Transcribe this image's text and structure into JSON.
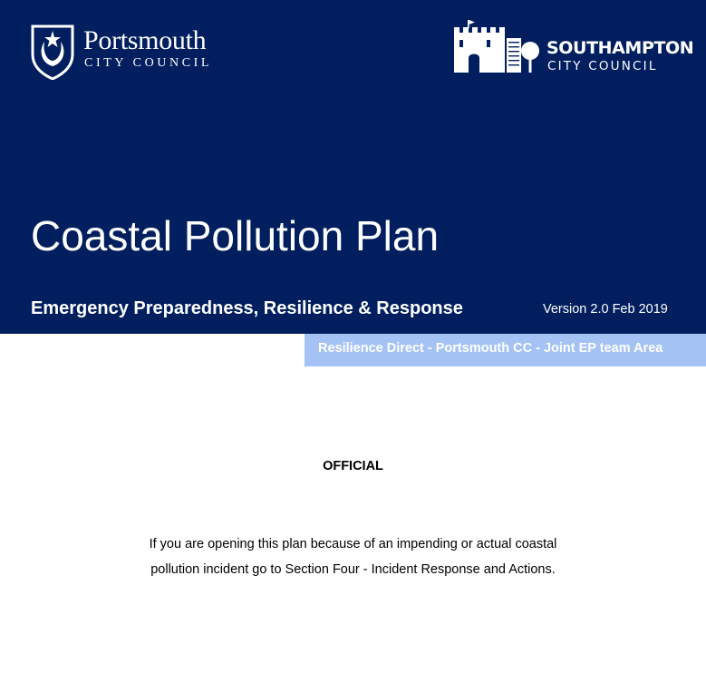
{
  "header": {
    "background_color": "#011e5e",
    "portsmouth_logo": {
      "icon": "portsmouth-crest-icon",
      "name": "Portsmouth",
      "subtitle": "CITY COUNCIL"
    },
    "southampton_logo": {
      "icon": "castle-icon",
      "name": "SOUTHAMPTON",
      "subtitle": "CITY COUNCIL"
    },
    "title": "Coastal Pollution Plan",
    "subtitle": "Emergency Preparedness, Resilience & Response",
    "version": "Version 2.0 Feb 2019"
  },
  "banner": {
    "text": "Resilience Direct - Portsmouth CC - Joint EP team Area",
    "background_color": "#a4c2f4"
  },
  "body": {
    "classification": "OFFICIAL",
    "notice_lines": [
      "If you are opening this plan because of an impending or actual coastal",
      "pollution incident go to Section Four - Incident Response and Actions."
    ]
  }
}
